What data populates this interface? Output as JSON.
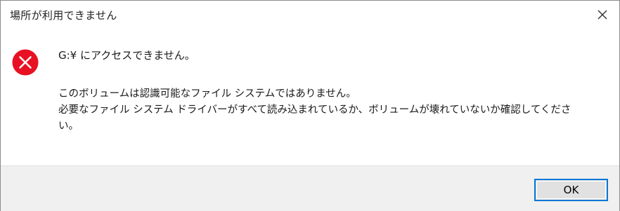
{
  "window": {
    "title": "場所が利用できません"
  },
  "icons": {
    "close": "close-icon",
    "error": "error-icon"
  },
  "colors": {
    "error_red": "#e81123",
    "accent": "#0078d7",
    "footer_bg": "#f0f0f0"
  },
  "message": {
    "headline": "G:¥ にアクセスできません。",
    "detail_lines": [
      "このボリュームは認識可能なファイル システムではありません。",
      "必要なファイル システム ドライバーがすべて読み込まれているか、ボリュームが壊れていないか確認してくださ",
      "い。"
    ]
  },
  "buttons": {
    "ok_label": "OK"
  }
}
